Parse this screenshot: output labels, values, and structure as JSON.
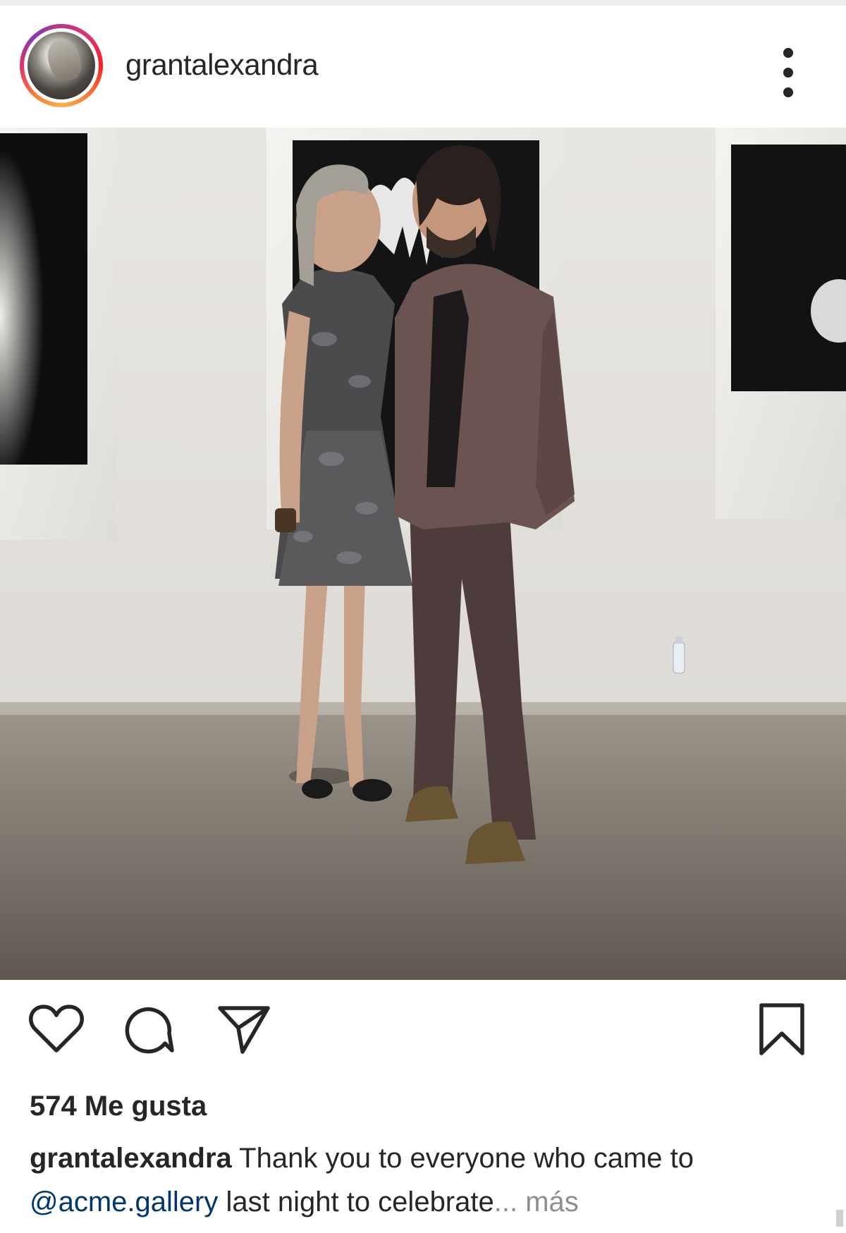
{
  "post": {
    "username": "grantalexandra",
    "photo_alt": "",
    "likes_text": "574 Me gusta",
    "caption": {
      "username": "grantalexandra",
      "text_line1": "Thank you to everyone who came to",
      "mention": "@acme.gallery",
      "text_line2": "last night to celebrate",
      "ellipsis": "...",
      "more_label": "más"
    }
  },
  "icons": {
    "more": "more-options-icon",
    "like": "heart-icon",
    "comment": "comment-icon",
    "share": "paper-plane-icon",
    "save": "bookmark-icon"
  },
  "colors": {
    "text": "#262626",
    "mention": "#00376b",
    "muted": "#8e8e8e",
    "story_ring_start": "#c13584",
    "story_ring_end": "#fcaf45"
  }
}
